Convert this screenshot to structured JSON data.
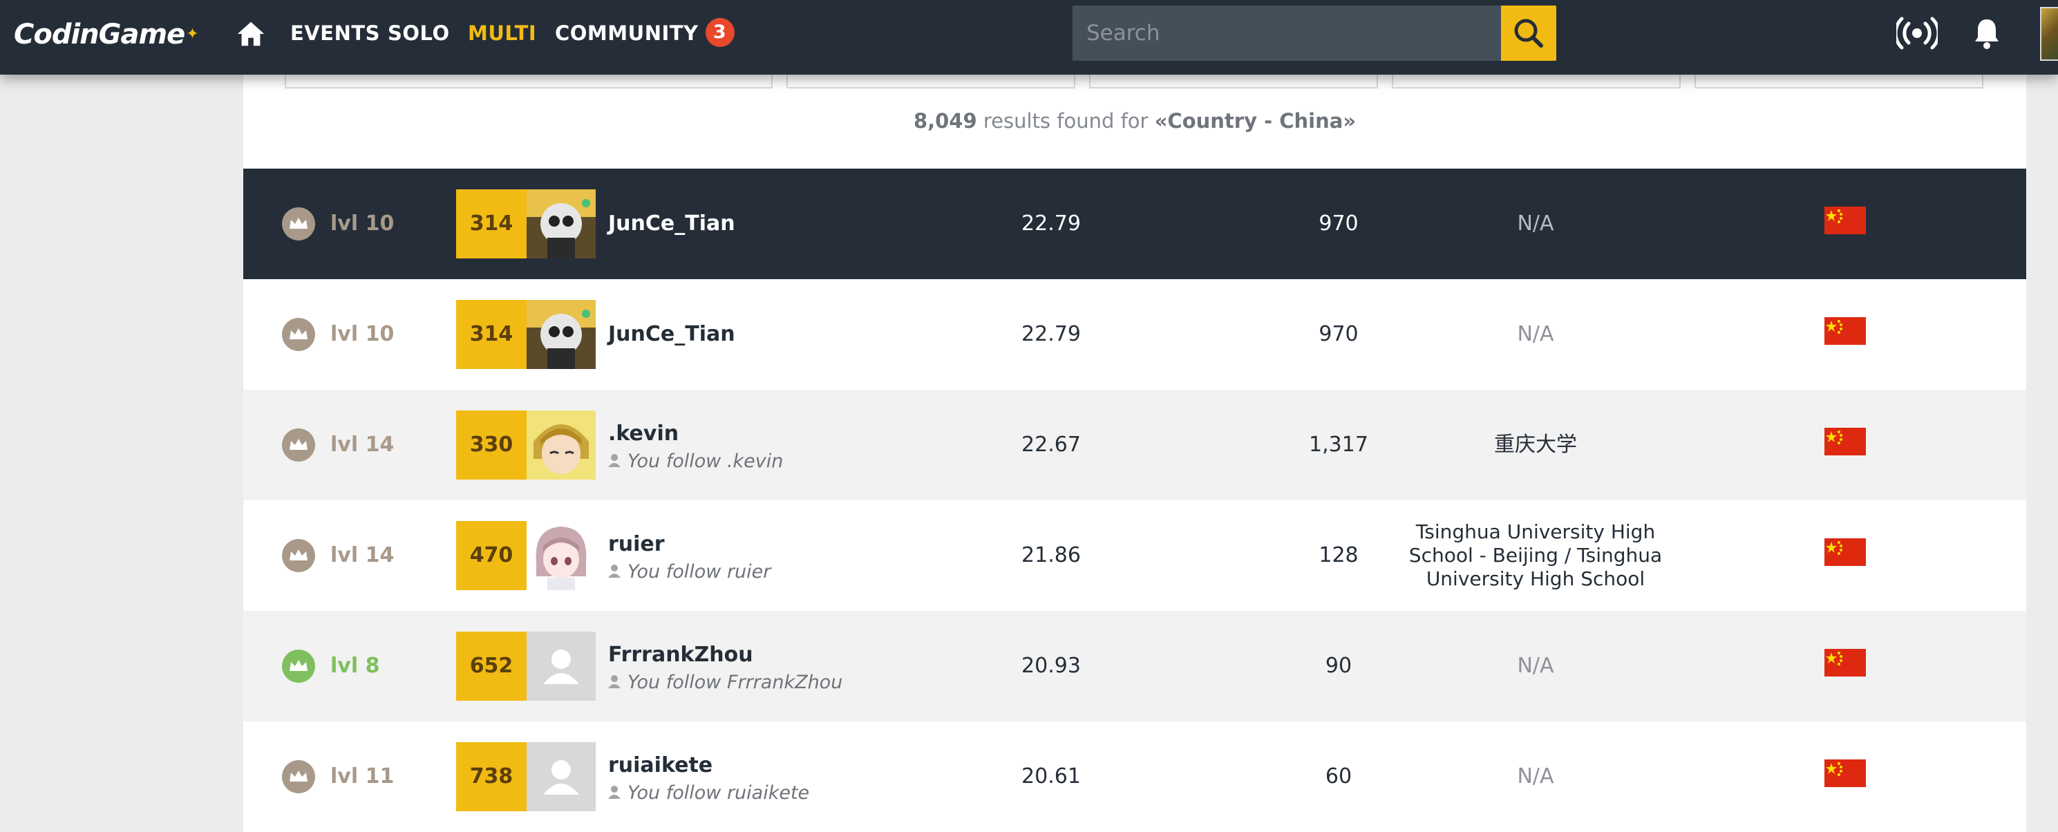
{
  "navbar": {
    "logo": "CodinGame",
    "items": [
      {
        "label": "EVENTS",
        "active": false
      },
      {
        "label": "SOLO",
        "active": false
      },
      {
        "label": "MULTI",
        "active": true
      },
      {
        "label": "COMMUNITY",
        "active": false,
        "badge": "3"
      }
    ],
    "search_placeholder": "Search",
    "icons": [
      "home-icon",
      "search-icon",
      "broadcast-icon",
      "bell-icon"
    ]
  },
  "results": {
    "count": "8,049",
    "middle": " results found for ",
    "query": "«Country - China»"
  },
  "colors": {
    "navbar_bg": "#252e38",
    "accent_yellow": "#f2bb13",
    "badge_red": "#e8492a",
    "level_gold": "#a8998a",
    "level_green": "#7fbf5f",
    "highlight_row": "#252e38"
  },
  "rows": [
    {
      "level": "lvl 10",
      "level_color": "gold",
      "rank": "314",
      "name": "JunCe_Tian",
      "follow": "",
      "score": "22.79",
      "points": "970",
      "school": "N/A",
      "school_na": true,
      "country": "China",
      "avatar": "robot",
      "highlight": true
    },
    {
      "level": "lvl 10",
      "level_color": "gold",
      "rank": "314",
      "name": "JunCe_Tian",
      "follow": "",
      "score": "22.79",
      "points": "970",
      "school": "N/A",
      "school_na": true,
      "country": "China",
      "avatar": "robot",
      "highlight": false
    },
    {
      "level": "lvl 14",
      "level_color": "gold",
      "rank": "330",
      "name": ".kevin",
      "follow": "You follow .kevin",
      "score": "22.67",
      "points": "1,317",
      "school": "重庆大学",
      "school_na": false,
      "country": "China",
      "avatar": "anime-yellow",
      "highlight": false
    },
    {
      "level": "lvl 14",
      "level_color": "gold",
      "rank": "470",
      "name": "ruier",
      "follow": "You follow ruier",
      "score": "21.86",
      "points": "128",
      "school": "Tsinghua University High School - Beijing / Tsinghua University High School",
      "school_na": false,
      "country": "China",
      "avatar": "anime-pink",
      "highlight": false
    },
    {
      "level": "lvl 8",
      "level_color": "green",
      "rank": "652",
      "name": "FrrrankZhou",
      "follow": "You follow FrrrankZhou",
      "score": "20.93",
      "points": "90",
      "school": "N/A",
      "school_na": true,
      "country": "China",
      "avatar": "default",
      "highlight": false
    },
    {
      "level": "lvl 11",
      "level_color": "gold",
      "rank": "738",
      "name": "ruiaikete",
      "follow": "You follow ruiaikete",
      "score": "20.61",
      "points": "60",
      "school": "N/A",
      "school_na": true,
      "country": "China",
      "avatar": "default",
      "highlight": false
    }
  ]
}
